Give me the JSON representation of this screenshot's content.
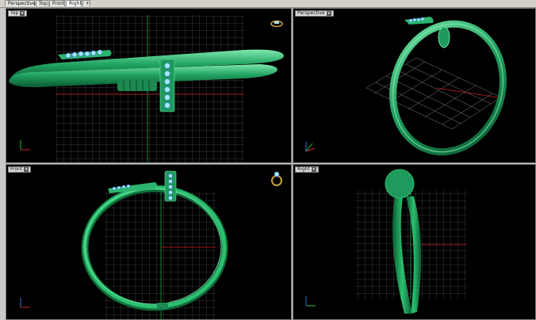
{
  "tabs": [
    {
      "label": "Perspective"
    },
    {
      "label": "Top"
    },
    {
      "label": "Front"
    },
    {
      "label": "Right",
      "active": true
    },
    {
      "label": "+"
    }
  ],
  "viewports": {
    "top": {
      "label": "Top"
    },
    "perspective": {
      "label": "Perspective"
    },
    "front": {
      "label": "Front"
    },
    "right": {
      "label": "Right"
    }
  },
  "dropdown_glyph": "▾",
  "colors": {
    "background": "#000000",
    "grid": "#7f7f7f",
    "ring": "#1e9a5c",
    "ring_highlight": "#6fe2a3",
    "axis_x": "#d02020",
    "axis_y": "#1fbf4f",
    "axis_z": "#2f6fd0",
    "gem": "#a8e6ff"
  },
  "icons": [
    "ring-icon",
    "axis-gizmo-icon",
    "dropdown-icon"
  ]
}
